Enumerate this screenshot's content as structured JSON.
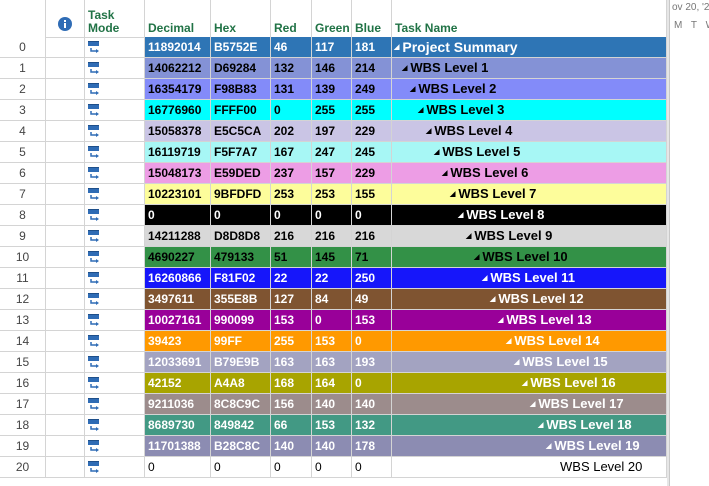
{
  "columns": {
    "indicator_icon": "info-icon",
    "task_mode": "Task Mode",
    "decimal": "Decimal",
    "hex": "Hex",
    "red": "Red",
    "green": "Green",
    "blue": "Blue",
    "task_name": "Task Name"
  },
  "timeline": {
    "date": "ov 20, '22",
    "days": "M T W"
  },
  "rows": [
    {
      "id": "0",
      "decimal": "11892014",
      "hex": "B5752E",
      "red": "46",
      "green": "117",
      "blue": "181",
      "name": "Project Summary",
      "level": 0,
      "bg": "#2E75B5",
      "fg": "#ffffff"
    },
    {
      "id": "1",
      "decimal": "14062212",
      "hex": "D69284",
      "red": "132",
      "green": "146",
      "blue": "214",
      "name": "WBS Level 1",
      "level": 1,
      "bg": "#8492D6",
      "fg": "#000000"
    },
    {
      "id": "2",
      "decimal": "16354179",
      "hex": "F98B83",
      "red": "131",
      "green": "139",
      "blue": "249",
      "name": "WBS Level 2",
      "level": 2,
      "bg": "#838BF9",
      "fg": "#000000"
    },
    {
      "id": "3",
      "decimal": "16776960",
      "hex": "FFFF00",
      "red": "0",
      "green": "255",
      "blue": "255",
      "name": "WBS Level 3",
      "level": 3,
      "bg": "#00FFFF",
      "fg": "#000000"
    },
    {
      "id": "4",
      "decimal": "15058378",
      "hex": "E5C5CA",
      "red": "202",
      "green": "197",
      "blue": "229",
      "name": "WBS Level 4",
      "level": 4,
      "bg": "#CAC5E5",
      "fg": "#000000"
    },
    {
      "id": "5",
      "decimal": "16119719",
      "hex": "F5F7A7",
      "red": "167",
      "green": "247",
      "blue": "245",
      "name": "WBS Level 5",
      "level": 5,
      "bg": "#A7F7F5",
      "fg": "#000000"
    },
    {
      "id": "6",
      "decimal": "15048173",
      "hex": "E59DED",
      "red": "237",
      "green": "157",
      "blue": "229",
      "name": "WBS Level 6",
      "level": 6,
      "bg": "#ED9DE5",
      "fg": "#000000"
    },
    {
      "id": "7",
      "decimal": "10223101",
      "hex": "9BFDFD",
      "red": "253",
      "green": "253",
      "blue": "155",
      "name": "WBS Level 7",
      "level": 7,
      "bg": "#FDFD9B",
      "fg": "#000000"
    },
    {
      "id": "8",
      "decimal": "0",
      "hex": "0",
      "red": "0",
      "green": "0",
      "blue": "0",
      "name": "WBS Level 8",
      "level": 8,
      "bg": "#000000",
      "fg": "#ffffff"
    },
    {
      "id": "9",
      "decimal": "14211288",
      "hex": "D8D8D8",
      "red": "216",
      "green": "216",
      "blue": "216",
      "name": "WBS Level 9",
      "level": 9,
      "bg": "#D8D8D8",
      "fg": "#000000"
    },
    {
      "id": "10",
      "decimal": "4690227",
      "hex": "479133",
      "red": "51",
      "green": "145",
      "blue": "71",
      "name": "WBS Level 10",
      "level": 10,
      "bg": "#339147",
      "fg": "#000000"
    },
    {
      "id": "11",
      "decimal": "16260866",
      "hex": "F81F02",
      "red": "22",
      "green": "22",
      "blue": "250",
      "name": "WBS Level 11",
      "level": 11,
      "bg": "#1616FA",
      "fg": "#ffffff"
    },
    {
      "id": "12",
      "decimal": "3497611",
      "hex": "355E8B",
      "red": "127",
      "green": "84",
      "blue": "49",
      "name": "WBS Level 12",
      "level": 12,
      "bg": "#7F5431",
      "fg": "#ffffff"
    },
    {
      "id": "13",
      "decimal": "10027161",
      "hex": "990099",
      "red": "153",
      "green": "0",
      "blue": "153",
      "name": "WBS Level 13",
      "level": 13,
      "bg": "#990099",
      "fg": "#ffffff"
    },
    {
      "id": "14",
      "decimal": "39423",
      "hex": "99FF",
      "red": "255",
      "green": "153",
      "blue": "0",
      "name": "WBS Level 14",
      "level": 14,
      "bg": "#FF9900",
      "fg": "#ffffff"
    },
    {
      "id": "15",
      "decimal": "12033691",
      "hex": "B79E9B",
      "red": "163",
      "green": "163",
      "blue": "193",
      "name": "WBS Level 15",
      "level": 15,
      "bg": "#A3A3C1",
      "fg": "#ffffff"
    },
    {
      "id": "16",
      "decimal": "42152",
      "hex": "A4A8",
      "red": "168",
      "green": "164",
      "blue": "0",
      "name": "WBS Level 16",
      "level": 16,
      "bg": "#A8A400",
      "fg": "#ffffff"
    },
    {
      "id": "17",
      "decimal": "9211036",
      "hex": "8C8C9C",
      "red": "156",
      "green": "140",
      "blue": "140",
      "name": "WBS Level 17",
      "level": 17,
      "bg": "#9C8C8C",
      "fg": "#ffffff"
    },
    {
      "id": "18",
      "decimal": "8689730",
      "hex": "849842",
      "red": "66",
      "green": "153",
      "blue": "132",
      "name": "WBS Level 18",
      "level": 18,
      "bg": "#429984",
      "fg": "#ffffff"
    },
    {
      "id": "19",
      "decimal": "11701388",
      "hex": "B28C8C",
      "red": "140",
      "green": "140",
      "blue": "178",
      "name": "WBS Level 19",
      "level": 19,
      "bg": "#8C8CB2",
      "fg": "#ffffff"
    },
    {
      "id": "20",
      "decimal": "0",
      "hex": "0",
      "red": "0",
      "green": "0",
      "blue": "0",
      "name": "WBS Level 20",
      "level": 20,
      "bg": "#ffffff",
      "fg": "#000000"
    }
  ]
}
